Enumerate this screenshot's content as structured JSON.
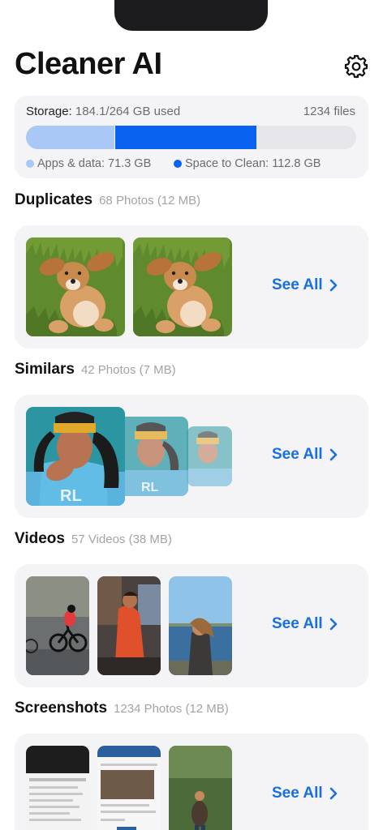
{
  "header": {
    "title": "Cleaner AI",
    "settings_icon": "gear-icon"
  },
  "storage": {
    "label": "Storage:",
    "used_text": "184.1/264 GB used",
    "files_text": "1234 files",
    "used_gb": 184.1,
    "total_gb": 264,
    "apps_gb": 71.3,
    "clean_gb": 112.8,
    "legend_apps": "Apps & data: 71.3 GB",
    "legend_clean": "Space to Clean: 112.8 GB",
    "colors": {
      "apps": "#a9c8f6",
      "clean": "#0a63f0",
      "track": "#e6e6ea"
    }
  },
  "sections": {
    "duplicates": {
      "title": "Duplicates",
      "subtitle": "68 Photos (12 MB)",
      "see_all": "See All"
    },
    "similars": {
      "title": "Similars",
      "subtitle": "42 Photos (7 MB)",
      "see_all": "See All"
    },
    "videos": {
      "title": "Videos",
      "subtitle": "57 Videos (38 MB)",
      "see_all": "See All"
    },
    "screenshots": {
      "title": "Screenshots",
      "subtitle": "1234 Photos (12 MB)",
      "see_all": "See All"
    }
  },
  "accent": "#1a6fe0"
}
